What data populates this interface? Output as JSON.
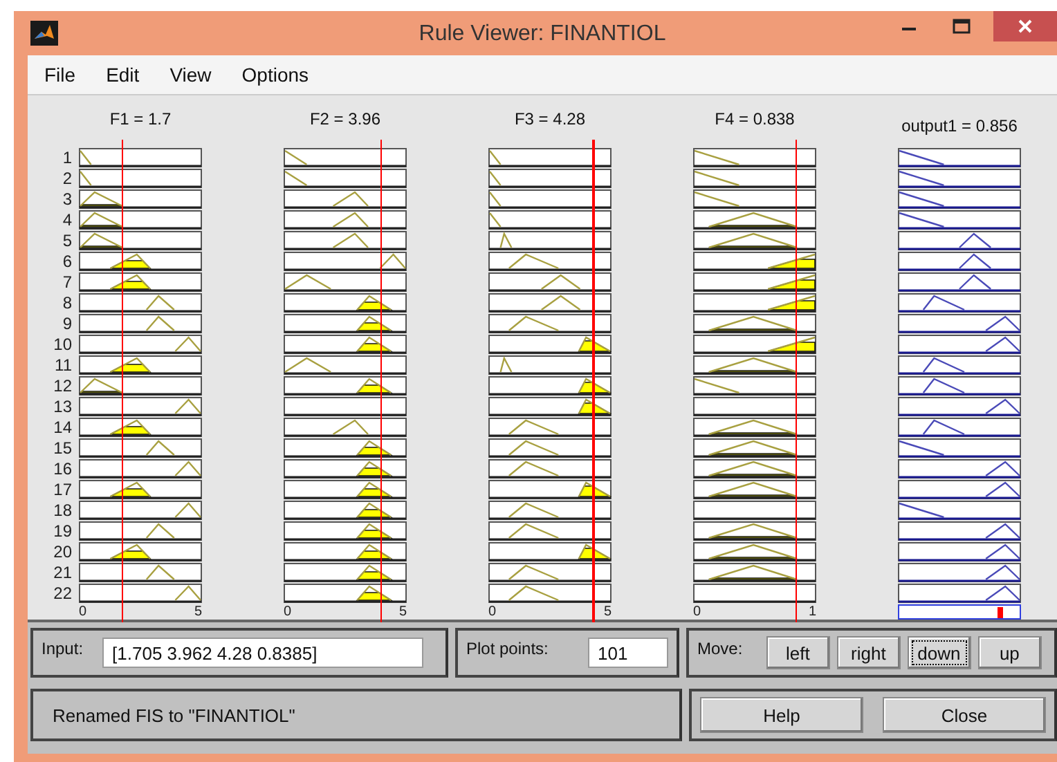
{
  "window": {
    "title": "Rule Viewer: FINANTIOL"
  },
  "menu": [
    "File",
    "Edit",
    "View",
    "Options"
  ],
  "variables": [
    {
      "kind": "input",
      "label": "F1 = 1.7",
      "ticks": [
        "0",
        "5"
      ]
    },
    {
      "kind": "input",
      "label": "F2 = 3.96",
      "ticks": [
        "0",
        "5"
      ]
    },
    {
      "kind": "input",
      "label": "F3 = 4.28",
      "ticks": [
        "0",
        "5"
      ]
    },
    {
      "kind": "input",
      "label": "F4 = 0.838",
      "ticks": [
        "0",
        "1"
      ]
    },
    {
      "kind": "output",
      "label": "output1 = 0.856"
    }
  ],
  "rules": [
    {
      "number": "1",
      "cells": [
        {
          "kind": "edge",
          "active": false
        },
        {
          "kind": "drop",
          "active": false
        },
        {
          "kind": "edge",
          "active": false
        },
        {
          "kind": "slope",
          "active": false
        },
        {
          "kind": "slope",
          "active": false
        }
      ]
    },
    {
      "number": "2",
      "cells": [
        {
          "kind": "edge",
          "active": false
        },
        {
          "kind": "drop",
          "active": false
        },
        {
          "kind": "edge",
          "active": false
        },
        {
          "kind": "slope",
          "active": false
        },
        {
          "kind": "slope",
          "active": false
        }
      ]
    },
    {
      "number": "3",
      "cells": [
        {
          "kind": "left",
          "active": true
        },
        {
          "kind": "middle",
          "active": false
        },
        {
          "kind": "edge",
          "active": false
        },
        {
          "kind": "slope",
          "active": false
        },
        {
          "kind": "slope",
          "active": false
        }
      ]
    },
    {
      "number": "4",
      "cells": [
        {
          "kind": "left",
          "active": true
        },
        {
          "kind": "middle",
          "active": false
        },
        {
          "kind": "edge",
          "active": false
        },
        {
          "kind": "centre",
          "active": true
        },
        {
          "kind": "slope",
          "active": false
        }
      ]
    },
    {
      "number": "5",
      "cells": [
        {
          "kind": "left",
          "active": true
        },
        {
          "kind": "middle",
          "active": false
        },
        {
          "kind": "spike",
          "active": false
        },
        {
          "kind": "centre",
          "active": true
        },
        {
          "kind": "raised",
          "active": false
        }
      ]
    },
    {
      "number": "6",
      "cells": [
        {
          "kind": "mid",
          "active": true
        },
        {
          "kind": "high",
          "active": false
        },
        {
          "kind": "lowmid",
          "active": false
        },
        {
          "kind": "rise",
          "active": true
        },
        {
          "kind": "raised",
          "active": false
        }
      ]
    },
    {
      "number": "7",
      "cells": [
        {
          "kind": "mid",
          "active": true
        },
        {
          "kind": "early",
          "active": false
        },
        {
          "kind": "upper",
          "active": false
        },
        {
          "kind": "rise",
          "active": true
        },
        {
          "kind": "raised",
          "active": false
        }
      ]
    },
    {
      "number": "8",
      "cells": [
        {
          "kind": "midhigh",
          "active": false
        },
        {
          "kind": "near",
          "active": true
        },
        {
          "kind": "upper",
          "active": false
        },
        {
          "kind": "rise",
          "active": true
        },
        {
          "kind": "quarter",
          "active": false
        }
      ]
    },
    {
      "number": "9",
      "cells": [
        {
          "kind": "midhigh",
          "active": false
        },
        {
          "kind": "near",
          "active": true
        },
        {
          "kind": "lowmid",
          "active": false
        },
        {
          "kind": "centre",
          "active": true
        },
        {
          "kind": "top",
          "active": false
        }
      ]
    },
    {
      "number": "10",
      "cells": [
        {
          "kind": "high",
          "active": false
        },
        {
          "kind": "near",
          "active": true
        },
        {
          "kind": "late",
          "active": true
        },
        {
          "kind": "rise",
          "active": true
        },
        {
          "kind": "top",
          "active": false
        }
      ]
    },
    {
      "number": "11",
      "cells": [
        {
          "kind": "mid",
          "active": true
        },
        {
          "kind": "early",
          "active": false
        },
        {
          "kind": "spike",
          "active": false
        },
        {
          "kind": "centre",
          "active": true
        },
        {
          "kind": "quarter",
          "active": false
        }
      ]
    },
    {
      "number": "12",
      "cells": [
        {
          "kind": "left",
          "active": true
        },
        {
          "kind": "near",
          "active": true
        },
        {
          "kind": "late",
          "active": true
        },
        {
          "kind": "slope",
          "active": false
        },
        {
          "kind": "quarter",
          "active": false
        }
      ]
    },
    {
      "number": "13",
      "cells": [
        {
          "kind": "high",
          "active": false
        },
        {
          "kind": "none"
        },
        {
          "kind": "late",
          "active": true
        },
        {
          "kind": "none"
        },
        {
          "kind": "top",
          "active": false
        }
      ]
    },
    {
      "number": "14",
      "cells": [
        {
          "kind": "mid",
          "active": true
        },
        {
          "kind": "middle",
          "active": false
        },
        {
          "kind": "lowmid",
          "active": false
        },
        {
          "kind": "centre",
          "active": true
        },
        {
          "kind": "quarter",
          "active": false
        }
      ]
    },
    {
      "number": "15",
      "cells": [
        {
          "kind": "midhigh",
          "active": false
        },
        {
          "kind": "near",
          "active": true
        },
        {
          "kind": "lowmid",
          "active": false
        },
        {
          "kind": "centre",
          "active": true
        },
        {
          "kind": "slope",
          "active": false
        }
      ]
    },
    {
      "number": "16",
      "cells": [
        {
          "kind": "high",
          "active": false
        },
        {
          "kind": "near",
          "active": true
        },
        {
          "kind": "lowmid",
          "active": false
        },
        {
          "kind": "centre",
          "active": true
        },
        {
          "kind": "top",
          "active": false
        }
      ]
    },
    {
      "number": "17",
      "cells": [
        {
          "kind": "mid",
          "active": true
        },
        {
          "kind": "near",
          "active": true
        },
        {
          "kind": "late",
          "active": true
        },
        {
          "kind": "centre",
          "active": true
        },
        {
          "kind": "top",
          "active": false
        }
      ]
    },
    {
      "number": "18",
      "cells": [
        {
          "kind": "high",
          "active": false
        },
        {
          "kind": "near",
          "active": true
        },
        {
          "kind": "lowmid",
          "active": false
        },
        {
          "kind": "none"
        },
        {
          "kind": "slope",
          "active": false
        }
      ]
    },
    {
      "number": "19",
      "cells": [
        {
          "kind": "midhigh",
          "active": false
        },
        {
          "kind": "near",
          "active": true
        },
        {
          "kind": "lowmid",
          "active": false
        },
        {
          "kind": "centre",
          "active": true
        },
        {
          "kind": "top",
          "active": false
        }
      ]
    },
    {
      "number": "20",
      "cells": [
        {
          "kind": "mid",
          "active": true
        },
        {
          "kind": "near",
          "active": true
        },
        {
          "kind": "late",
          "active": true
        },
        {
          "kind": "centre",
          "active": true
        },
        {
          "kind": "top",
          "active": false
        }
      ]
    },
    {
      "number": "21",
      "cells": [
        {
          "kind": "midhigh",
          "active": false
        },
        {
          "kind": "near",
          "active": true
        },
        {
          "kind": "lowmid",
          "active": false
        },
        {
          "kind": "centre",
          "active": true
        },
        {
          "kind": "top",
          "active": false
        }
      ]
    },
    {
      "number": "22",
      "cells": [
        {
          "kind": "high",
          "active": false
        },
        {
          "kind": "near",
          "active": true
        },
        {
          "kind": "lowmid",
          "active": false
        },
        {
          "kind": "none"
        },
        {
          "kind": "top",
          "active": false
        }
      ]
    }
  ],
  "input": {
    "label": "Input:",
    "value": "[1.705 3.962 4.28 0.8385]"
  },
  "plot_points": {
    "label": "Plot points:",
    "value": "101"
  },
  "move": {
    "label": "Move:",
    "buttons": [
      {
        "label": "left",
        "focused": false
      },
      {
        "label": "right",
        "focused": false
      },
      {
        "label": "down",
        "focused": true
      },
      {
        "label": "up",
        "focused": false
      }
    ]
  },
  "status": "Renamed FIS to \"FINANTIOL\"",
  "buttons": [
    "Help",
    "Close"
  ]
}
